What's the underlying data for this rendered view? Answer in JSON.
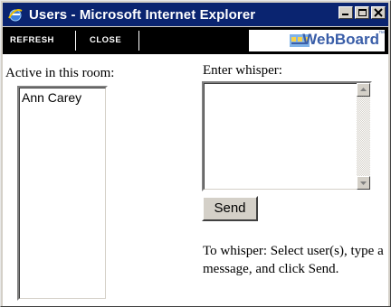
{
  "window": {
    "title": "Users - Microsoft Internet Explorer",
    "icon": "ie-icon",
    "controls": [
      "minimize-icon",
      "maximize-icon",
      "close-icon"
    ]
  },
  "toolbar": {
    "refresh_label": "REFRESH",
    "close_label": "CLOSE",
    "logo_text": "WebBoard",
    "logo_tm": "™"
  },
  "room": {
    "label": "Active in this room:",
    "users": [
      "Ann Carey"
    ]
  },
  "whisper": {
    "label": "Enter whisper:",
    "value": "",
    "send_label": "Send",
    "help_text": "To whisper: Select user(s), type a message, and click Send."
  },
  "colors": {
    "titlebar": "#0a2470",
    "toolbar": "#000000",
    "logo": "#3a5ea8"
  }
}
